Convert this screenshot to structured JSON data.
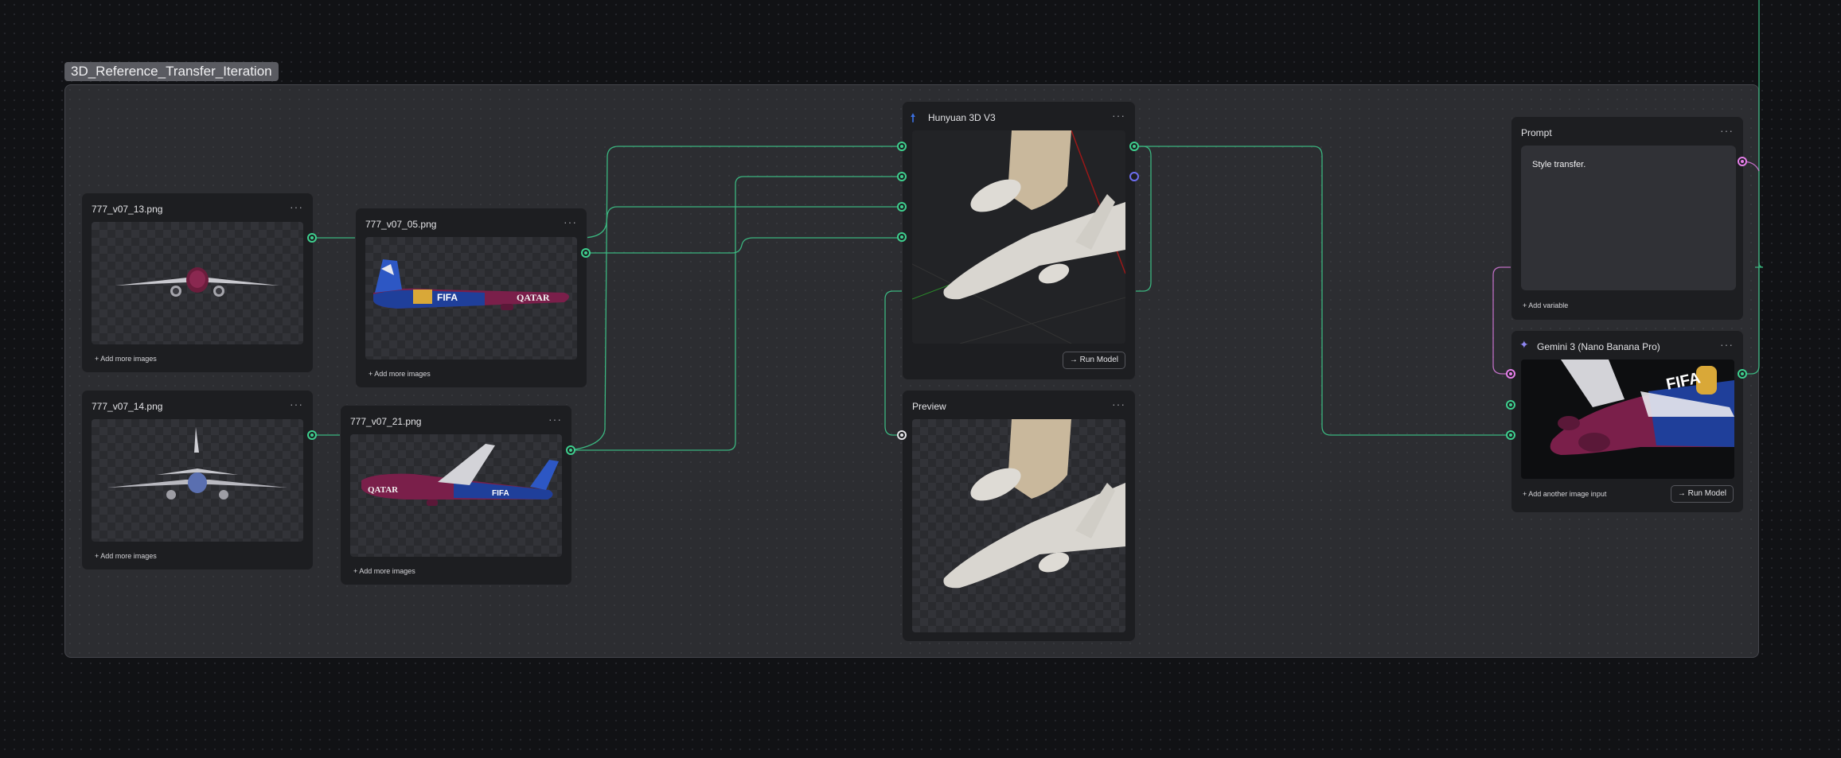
{
  "group": {
    "label": "3D_Reference_Transfer_Iteration"
  },
  "nodes": {
    "img13": {
      "title": "777_v07_13.png",
      "menu": "···",
      "add_more": "+ Add more images"
    },
    "img14": {
      "title": "777_v07_14.png",
      "menu": "···",
      "add_more": "+ Add more images"
    },
    "img05": {
      "title": "777_v07_05.png",
      "menu": "···",
      "add_more": "+ Add more images"
    },
    "img21": {
      "title": "777_v07_21.png",
      "menu": "···",
      "add_more": "+ Add more images"
    },
    "hunyuan": {
      "title": "Hunyuan 3D V3",
      "menu": "···",
      "run": "→ Run Model",
      "icon": "hunyuan-logo-icon"
    },
    "preview": {
      "title": "Preview",
      "menu": "···"
    },
    "prompt": {
      "title": "Prompt",
      "menu": "···",
      "text": "Style transfer.",
      "add_variable": "+ Add variable"
    },
    "gemini": {
      "title": "Gemini 3 (Nano Banana Pro)",
      "menu": "···",
      "add_input": "+ Add another image input",
      "run": "→ Run Model",
      "icon": "sparkle-icon"
    }
  },
  "colors": {
    "wire": "#3ecf8e",
    "wire_pink": "#e47ee8",
    "port_hollow": "#6c6df0",
    "livery_purple": "#7a1f4a",
    "livery_blue": "#1f3f9a"
  }
}
